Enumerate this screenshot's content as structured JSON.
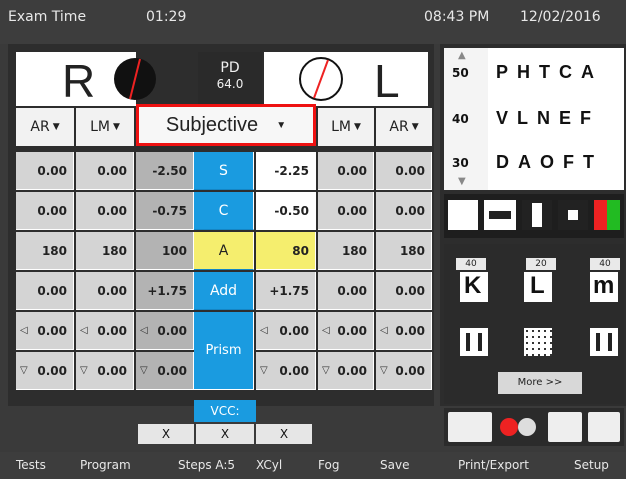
{
  "topbar": {
    "exam_label": "Exam Time",
    "elapsed": "01:29",
    "clock": "08:43 PM",
    "date": "12/02/2016"
  },
  "eyes": {
    "right_letter": "R",
    "left_letter": "L",
    "pd_label": "PD",
    "pd_value": "64.0"
  },
  "selectors": {
    "ar_left": "AR",
    "lm_left": "LM",
    "mode": "Subjective",
    "lm_right": "LM",
    "ar_right": "AR"
  },
  "rows": [
    {
      "label": "S",
      "ar_r": "0.00",
      "lm_r": "0.00",
      "subj_r": "-2.50",
      "subj_l": "-2.25",
      "lm_l": "0.00",
      "ar_l": "0.00"
    },
    {
      "label": "C",
      "ar_r": "0.00",
      "lm_r": "0.00",
      "subj_r": "-0.75",
      "subj_l": "-0.50",
      "lm_l": "0.00",
      "ar_l": "0.00"
    },
    {
      "label": "A",
      "ar_r": "180",
      "lm_r": "180",
      "subj_r": "100",
      "subj_l": "80",
      "lm_l": "180",
      "ar_l": "180"
    },
    {
      "label": "Add",
      "ar_r": "0.00",
      "lm_r": "0.00",
      "subj_r": "+1.75",
      "subj_l": "+1.75",
      "lm_l": "0.00",
      "ar_l": "0.00"
    }
  ],
  "prism": {
    "label": "Prism",
    "row1": {
      "ar_r": "0.00",
      "lm_r": "0.00",
      "subj_r": "0.00",
      "subj_l": "0.00",
      "lm_l": "0.00",
      "ar_l": "0.00"
    },
    "row2": {
      "ar_r": "0.00",
      "lm_r": "0.00",
      "subj_r": "0.00",
      "subj_l": "0.00",
      "lm_l": "0.00",
      "ar_l": "0.00"
    }
  },
  "vcc": {
    "label": "VCC:",
    "x1": "X",
    "x2": "X",
    "x3": "X"
  },
  "chart": {
    "rows": [
      {
        "size": "50",
        "letters": "PHTCA"
      },
      {
        "size": "40",
        "letters": "VLNEF"
      },
      {
        "size": "30",
        "letters": "DAOFT"
      }
    ]
  },
  "optotypes": {
    "k_tag": "40",
    "l_tag": "20",
    "m_tag": "40",
    "k": "K",
    "l": "L",
    "m": "m",
    "more": "More >>"
  },
  "bottombar": {
    "tests": "Tests",
    "program": "Program",
    "steps": "Steps A:5",
    "xcyl": "XCyl",
    "fog": "Fog",
    "save": "Save",
    "print": "Print/Export",
    "setup": "Setup"
  },
  "colors": {
    "accent": "#1a9be0",
    "highlight": "#f5ee6e",
    "selection_outline": "#e11111"
  }
}
